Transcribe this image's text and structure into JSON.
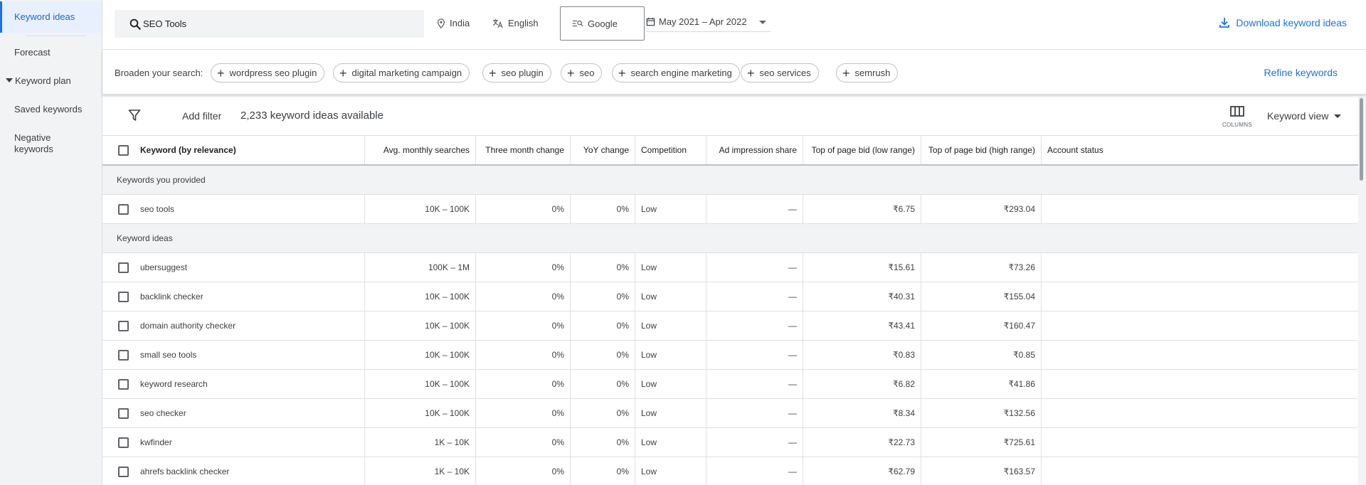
{
  "sidebar": {
    "items": [
      {
        "label": "Keyword ideas"
      },
      {
        "label": "Forecast"
      },
      {
        "label": "Keyword plan"
      },
      {
        "label": "Saved keywords"
      },
      {
        "label": "Negative keywords"
      }
    ]
  },
  "topbar": {
    "search_value": "SEO Tools",
    "location": "India",
    "language": "English",
    "network": "Google",
    "date_range": "May 2021 – Apr 2022",
    "download_label": "Download keyword ideas"
  },
  "broaden": {
    "label": "Broaden your search:",
    "chips": [
      "wordpress seo plugin",
      "digital marketing campaign",
      "seo plugin",
      "seo",
      "search engine marketing",
      "seo services",
      "semrush"
    ],
    "refine_label": "Refine keywords"
  },
  "filter": {
    "add_filter_label": "Add filter",
    "ideas_count": "2,233 keyword ideas available",
    "columns_label": "COLUMNS",
    "view_label": "Keyword view"
  },
  "table": {
    "headers": [
      "Keyword (by relevance)",
      "Avg. monthly searches",
      "Three month change",
      "YoY change",
      "Competition",
      "Ad impression share",
      "Top of page bid (low range)",
      "Top of page bid (high range)",
      "Account status"
    ],
    "provided_section": "Keywords you provided",
    "provided_rows": [
      [
        "seo tools",
        "10K – 100K",
        "0%",
        "0%",
        "Low",
        "—",
        "₹6.75",
        "₹293.04",
        ""
      ]
    ],
    "ideas_section": "Keyword ideas",
    "idea_rows": [
      [
        "ubersuggest",
        "100K – 1M",
        "0%",
        "0%",
        "Low",
        "—",
        "₹15.61",
        "₹73.26",
        ""
      ],
      [
        "backlink checker",
        "10K – 100K",
        "0%",
        "0%",
        "Low",
        "—",
        "₹40.31",
        "₹155.04",
        ""
      ],
      [
        "domain authority checker",
        "10K – 100K",
        "0%",
        "0%",
        "Low",
        "—",
        "₹43.41",
        "₹160.47",
        ""
      ],
      [
        "small seo tools",
        "10K – 100K",
        "0%",
        "0%",
        "Low",
        "—",
        "₹0.83",
        "₹0.85",
        ""
      ],
      [
        "keyword research",
        "10K – 100K",
        "0%",
        "0%",
        "Low",
        "—",
        "₹6.82",
        "₹41.86",
        ""
      ],
      [
        "seo checker",
        "10K – 100K",
        "0%",
        "0%",
        "Low",
        "—",
        "₹8.34",
        "₹132.56",
        ""
      ],
      [
        "kwfinder",
        "1K – 10K",
        "0%",
        "0%",
        "Low",
        "—",
        "₹22.73",
        "₹725.61",
        ""
      ],
      [
        "ahrefs backlink checker",
        "1K – 10K",
        "0%",
        "0%",
        "Low",
        "—",
        "₹62.79",
        "₹163.57",
        ""
      ]
    ]
  },
  "colors": {
    "accent": "#1a73e8",
    "active_bg": "#e8f0fe",
    "section_bg": "#f1f3f4"
  }
}
